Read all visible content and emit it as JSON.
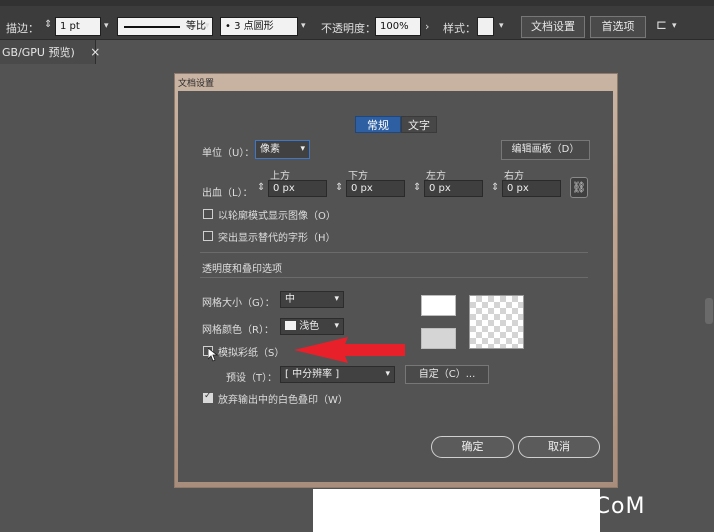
{
  "control_bar": {
    "stroke_label": "描边：",
    "stroke_value": "1 pt",
    "stroke_profile": "等比",
    "brush_value": "3 点圆形",
    "opacity_label": "不透明度：",
    "opacity_value": "100%",
    "style_label": "样式：",
    "doc_setup_button": "文档设置",
    "prefs_button": "首选项"
  },
  "document_tab": {
    "label": "GB/GPU 预览)",
    "close": "×"
  },
  "dialog": {
    "title": "文档设置",
    "tabs": [
      {
        "label": "常规",
        "active": true
      },
      {
        "label": "文字",
        "active": false
      }
    ],
    "units_label": "单位（U）：",
    "units_value": "像素",
    "edit_artboards_button": "编辑画板（D）",
    "bleed_label": "出血（L）：",
    "bleed": [
      {
        "label": "上方",
        "value": "0 px"
      },
      {
        "label": "下方",
        "value": "0 px"
      },
      {
        "label": "左方",
        "value": "0 px"
      },
      {
        "label": "右方",
        "value": "0 px"
      }
    ],
    "outline_images_label": "以轮廓模式显示图像（O）",
    "highlight_glyphs_label": "突出显示替代的字形（H）",
    "section_title": "透明度和叠印选项",
    "grid_size_label": "网格大小（G）：",
    "grid_size_value": "中",
    "grid_color_label": "网格颜色（R）：",
    "grid_color_value": "浅色",
    "simulate_paper_label": "模拟彩纸（S）",
    "preset_label": "预设（T）：",
    "preset_value": "[ 中分辨率 ]",
    "custom_button": "自定（C）...",
    "discard_white_label": "放弃输出中的白色叠印（W）",
    "discard_white_checked": true,
    "ok_button": "确定",
    "cancel_button": "取消"
  },
  "watermark": "UiBQ.CoM",
  "colors": {
    "panel": "#535353",
    "annotation_arrow": "#e8202a"
  }
}
